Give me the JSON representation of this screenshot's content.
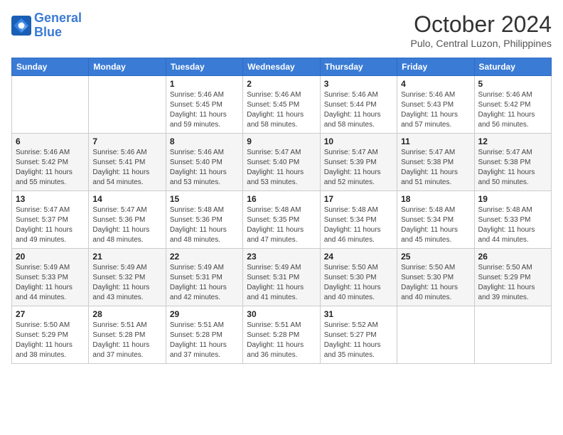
{
  "header": {
    "logo_line1": "General",
    "logo_line2": "Blue",
    "title": "October 2024",
    "subtitle": "Pulo, Central Luzon, Philippines"
  },
  "weekdays": [
    "Sunday",
    "Monday",
    "Tuesday",
    "Wednesday",
    "Thursday",
    "Friday",
    "Saturday"
  ],
  "weeks": [
    [
      {
        "day": null,
        "detail": null
      },
      {
        "day": null,
        "detail": null
      },
      {
        "day": "1",
        "detail": "Sunrise: 5:46 AM\nSunset: 5:45 PM\nDaylight: 11 hours and 59 minutes."
      },
      {
        "day": "2",
        "detail": "Sunrise: 5:46 AM\nSunset: 5:45 PM\nDaylight: 11 hours and 58 minutes."
      },
      {
        "day": "3",
        "detail": "Sunrise: 5:46 AM\nSunset: 5:44 PM\nDaylight: 11 hours and 58 minutes."
      },
      {
        "day": "4",
        "detail": "Sunrise: 5:46 AM\nSunset: 5:43 PM\nDaylight: 11 hours and 57 minutes."
      },
      {
        "day": "5",
        "detail": "Sunrise: 5:46 AM\nSunset: 5:42 PM\nDaylight: 11 hours and 56 minutes."
      }
    ],
    [
      {
        "day": "6",
        "detail": "Sunrise: 5:46 AM\nSunset: 5:42 PM\nDaylight: 11 hours and 55 minutes."
      },
      {
        "day": "7",
        "detail": "Sunrise: 5:46 AM\nSunset: 5:41 PM\nDaylight: 11 hours and 54 minutes."
      },
      {
        "day": "8",
        "detail": "Sunrise: 5:46 AM\nSunset: 5:40 PM\nDaylight: 11 hours and 53 minutes."
      },
      {
        "day": "9",
        "detail": "Sunrise: 5:47 AM\nSunset: 5:40 PM\nDaylight: 11 hours and 53 minutes."
      },
      {
        "day": "10",
        "detail": "Sunrise: 5:47 AM\nSunset: 5:39 PM\nDaylight: 11 hours and 52 minutes."
      },
      {
        "day": "11",
        "detail": "Sunrise: 5:47 AM\nSunset: 5:38 PM\nDaylight: 11 hours and 51 minutes."
      },
      {
        "day": "12",
        "detail": "Sunrise: 5:47 AM\nSunset: 5:38 PM\nDaylight: 11 hours and 50 minutes."
      }
    ],
    [
      {
        "day": "13",
        "detail": "Sunrise: 5:47 AM\nSunset: 5:37 PM\nDaylight: 11 hours and 49 minutes."
      },
      {
        "day": "14",
        "detail": "Sunrise: 5:47 AM\nSunset: 5:36 PM\nDaylight: 11 hours and 48 minutes."
      },
      {
        "day": "15",
        "detail": "Sunrise: 5:48 AM\nSunset: 5:36 PM\nDaylight: 11 hours and 48 minutes."
      },
      {
        "day": "16",
        "detail": "Sunrise: 5:48 AM\nSunset: 5:35 PM\nDaylight: 11 hours and 47 minutes."
      },
      {
        "day": "17",
        "detail": "Sunrise: 5:48 AM\nSunset: 5:34 PM\nDaylight: 11 hours and 46 minutes."
      },
      {
        "day": "18",
        "detail": "Sunrise: 5:48 AM\nSunset: 5:34 PM\nDaylight: 11 hours and 45 minutes."
      },
      {
        "day": "19",
        "detail": "Sunrise: 5:48 AM\nSunset: 5:33 PM\nDaylight: 11 hours and 44 minutes."
      }
    ],
    [
      {
        "day": "20",
        "detail": "Sunrise: 5:49 AM\nSunset: 5:33 PM\nDaylight: 11 hours and 44 minutes."
      },
      {
        "day": "21",
        "detail": "Sunrise: 5:49 AM\nSunset: 5:32 PM\nDaylight: 11 hours and 43 minutes."
      },
      {
        "day": "22",
        "detail": "Sunrise: 5:49 AM\nSunset: 5:31 PM\nDaylight: 11 hours and 42 minutes."
      },
      {
        "day": "23",
        "detail": "Sunrise: 5:49 AM\nSunset: 5:31 PM\nDaylight: 11 hours and 41 minutes."
      },
      {
        "day": "24",
        "detail": "Sunrise: 5:50 AM\nSunset: 5:30 PM\nDaylight: 11 hours and 40 minutes."
      },
      {
        "day": "25",
        "detail": "Sunrise: 5:50 AM\nSunset: 5:30 PM\nDaylight: 11 hours and 40 minutes."
      },
      {
        "day": "26",
        "detail": "Sunrise: 5:50 AM\nSunset: 5:29 PM\nDaylight: 11 hours and 39 minutes."
      }
    ],
    [
      {
        "day": "27",
        "detail": "Sunrise: 5:50 AM\nSunset: 5:29 PM\nDaylight: 11 hours and 38 minutes."
      },
      {
        "day": "28",
        "detail": "Sunrise: 5:51 AM\nSunset: 5:28 PM\nDaylight: 11 hours and 37 minutes."
      },
      {
        "day": "29",
        "detail": "Sunrise: 5:51 AM\nSunset: 5:28 PM\nDaylight: 11 hours and 37 minutes."
      },
      {
        "day": "30",
        "detail": "Sunrise: 5:51 AM\nSunset: 5:28 PM\nDaylight: 11 hours and 36 minutes."
      },
      {
        "day": "31",
        "detail": "Sunrise: 5:52 AM\nSunset: 5:27 PM\nDaylight: 11 hours and 35 minutes."
      },
      {
        "day": null,
        "detail": null
      },
      {
        "day": null,
        "detail": null
      }
    ]
  ]
}
